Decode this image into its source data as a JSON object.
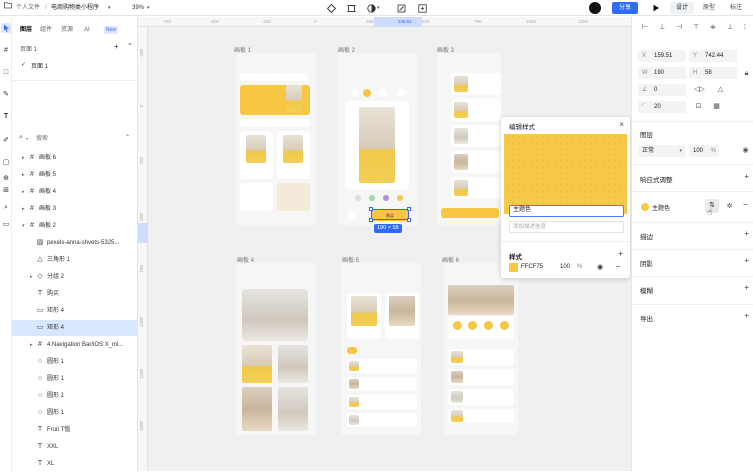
{
  "topbar": {
    "breadcrumb_root": "个人文件",
    "breadcrumb_sep": "/",
    "file_name": "电商购物类小程序",
    "zoom": "39%",
    "share_label": "分享",
    "modes": [
      "设计",
      "原型",
      "标注"
    ],
    "active_mode": "设计"
  },
  "leftpanel": {
    "tabs": [
      "图层",
      "组件",
      "资源",
      "AI"
    ],
    "new_badge": "New",
    "pages_label": "页面 1",
    "page_item": "页面 1",
    "search_placeholder": "搜索",
    "layers": [
      {
        "label": "画板 6",
        "icon": "#"
      },
      {
        "label": "画板 5",
        "icon": "#"
      },
      {
        "label": "画板 4",
        "icon": "#"
      },
      {
        "label": "画板 3",
        "icon": "#"
      },
      {
        "label": "画板 2",
        "icon": "#"
      },
      {
        "label": "pexels-anna-shvets-5325...",
        "icon": "▧"
      },
      {
        "label": "三角形 1",
        "icon": "△"
      },
      {
        "label": "分组 2",
        "icon": "◇"
      },
      {
        "label": "购买",
        "icon": "T"
      },
      {
        "label": "矩形 4",
        "icon": "▭"
      },
      {
        "label": "矩形 4",
        "icon": "▭"
      },
      {
        "label": "4.Navigation Bar/iOS X_mi...",
        "icon": "#"
      },
      {
        "label": "圆形 1",
        "icon": "○"
      },
      {
        "label": "圆形 1",
        "icon": "○"
      },
      {
        "label": "圆形 1",
        "icon": "○"
      },
      {
        "label": "圆形 1",
        "icon": "○"
      },
      {
        "label": "Fruit T恤",
        "icon": "T"
      },
      {
        "label": "XXL",
        "icon": "T"
      },
      {
        "label": "XL",
        "icon": "T"
      }
    ]
  },
  "canvas": {
    "ruler_top": [
      "-750",
      "-500",
      "-250",
      "0",
      "250",
      "346.51",
      "500",
      "750",
      "1000",
      "1250"
    ],
    "ruler_left": [
      "-250",
      "0",
      "250",
      "500",
      "750",
      "1000",
      "1250",
      "1500"
    ],
    "frames": [
      "画板 1",
      "画板 2",
      "画板 3",
      "画板 4",
      "画板 5",
      "画板 6"
    ],
    "selection_size": "190 × 58",
    "buy_label": "购买"
  },
  "popup": {
    "title": "编辑样式",
    "name_value": "主题色",
    "desc_placeholder": "添加描述信息",
    "style_label": "样式",
    "color_hex": "FFCF75",
    "opacity": "100",
    "opacity_unit": "%",
    "swatch_color": "#f7c94a"
  },
  "rightpanel": {
    "x_label": "X",
    "x_value": "159.51",
    "y_label": "Y",
    "y_value": "742.44",
    "w_label": "W",
    "w_value": "190",
    "h_label": "H",
    "h_value": "58",
    "rotation": "0",
    "radius": "20",
    "layer_section": "图层",
    "blend_mode": "正常",
    "layer_opacity": "100",
    "opacity_unit": "%",
    "responsive_section": "响应式调整",
    "fill_name": "主题色",
    "sections": [
      "描边",
      "阴影",
      "模糊",
      "导出"
    ]
  },
  "colors": {
    "accent": "#2f6bff",
    "theme_yellow": "#f7c744",
    "selection_bg": "#d9e6ff"
  }
}
